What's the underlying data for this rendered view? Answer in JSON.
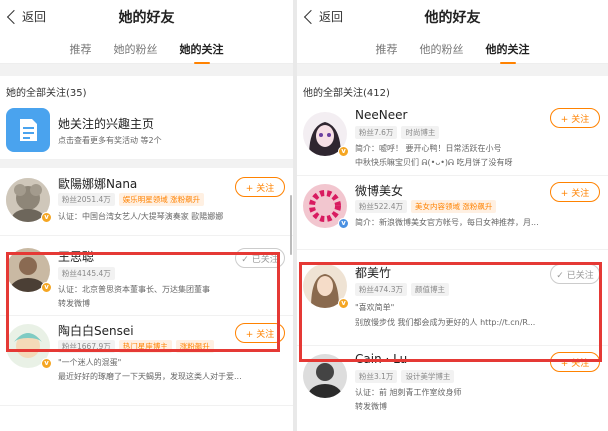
{
  "left": {
    "back_label": "返回",
    "title": "她的好友",
    "tabs": [
      "推荐",
      "她的粉丝",
      "她的关注"
    ],
    "active_tab": 2,
    "section_title": "她的全部关注(35)",
    "interest": {
      "title": "她关注的兴趣主页",
      "subtitle": "点击查看更多有奖活动 等2个"
    },
    "users": [
      {
        "name": "歐陽娜娜Nana",
        "fans": "粉丝2051.4万",
        "tags": [
          "娱乐明星领域 涨粉飙升"
        ],
        "desc": "认证：中国台湾女艺人/大提琴演奏家 歐陽娜娜",
        "desc2": "",
        "button": "+ 关注",
        "followed": false
      },
      {
        "name": "王思聪",
        "fans": "粉丝4145.4万",
        "tags": [],
        "desc": "认证：北京普思资本董事长、万达集团董事",
        "desc2": "转发微博",
        "button": "✓ 已关注",
        "followed": true
      },
      {
        "name": "陶白白Sensei",
        "fans": "粉丝1667.9万",
        "tags": [
          "热门星座博主",
          "涨粉飙升"
        ],
        "desc": "\"一个迷人的混蛋\"",
        "desc2": "最近好好的琢磨了一下天蝎男，发现这类人对于爱...",
        "button": "+ 关注",
        "followed": false
      }
    ]
  },
  "right": {
    "back_label": "返回",
    "title": "他的好友",
    "tabs": [
      "推荐",
      "他的粉丝",
      "他的关注"
    ],
    "active_tab": 2,
    "section_title": "他的全部关注(412)",
    "users": [
      {
        "name": "NeeNeer",
        "fans": "粉丝7.6万",
        "tags": [
          "时尚博主"
        ],
        "desc": "简介：嘘呼！ 要开心鸭！日常活跃在小号",
        "desc2": "中秋快乐嘛宝贝们 ᕱ(•ᴗ•)ᕱ 吃月饼了没有呀",
        "button": "+ 关注",
        "followed": false
      },
      {
        "name": "微博美女",
        "fans": "粉丝522.4万",
        "tags": [
          "美女内容领域 涨粉飙升"
        ],
        "desc": "简介：新浪微博美女官方帐号，每日女神推荐，月...",
        "desc2": "",
        "button": "+ 关注",
        "followed": false
      },
      {
        "name": "都美竹",
        "fans": "粉丝474.3万",
        "tags": [
          "颜值博主"
        ],
        "desc": "\"喜欢简单\"",
        "desc2": "别放慢步伐 我们都会成为更好的人 http://t.cn/R...",
        "button": "✓ 已关注",
        "followed": true
      },
      {
        "name": "Cain · Lu",
        "fans": "粉丝3.1万",
        "tags": [
          "设计美学博主"
        ],
        "desc": "认证：前 旭刺青工作室纹身师",
        "desc2": "转发微博",
        "button": "+ 关注",
        "followed": false
      }
    ]
  },
  "colors": {
    "accent": "#ff8200",
    "highlight": "#e53935",
    "verified_gold": "#f5a623",
    "verified_blue": "#4a90e2"
  },
  "icons": {
    "back": "chevron-left-icon",
    "interest": "document-icon",
    "check": "check-icon",
    "plus": "plus-icon"
  }
}
